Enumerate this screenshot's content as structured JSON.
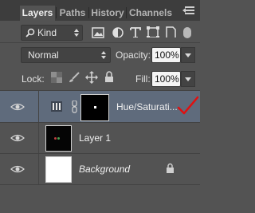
{
  "tabs": [
    {
      "label": "Layers",
      "active": true
    },
    {
      "label": "Paths",
      "active": false
    },
    {
      "label": "History",
      "active": false
    },
    {
      "label": "Channels",
      "active": false
    }
  ],
  "filter": {
    "value": "Kind",
    "icon": "search-icon"
  },
  "blend": {
    "value": "Normal"
  },
  "opacity": {
    "label": "Opacity:",
    "value": "100%"
  },
  "lock": {
    "label": "Lock:"
  },
  "fill": {
    "label": "Fill:",
    "value": "100%"
  },
  "layers": [
    {
      "name": "Hue/Saturati...",
      "type": "adjustment",
      "selected": true,
      "italic": false
    },
    {
      "name": "Layer 1",
      "type": "pixel",
      "selected": false,
      "italic": false
    },
    {
      "name": "Background",
      "type": "background",
      "selected": false,
      "italic": true,
      "locked": true
    }
  ],
  "colors": {
    "panel": "#535353",
    "tabbar": "#3d3d3d",
    "selected_row": "#5f6b7c",
    "annotation": "#e01010"
  }
}
